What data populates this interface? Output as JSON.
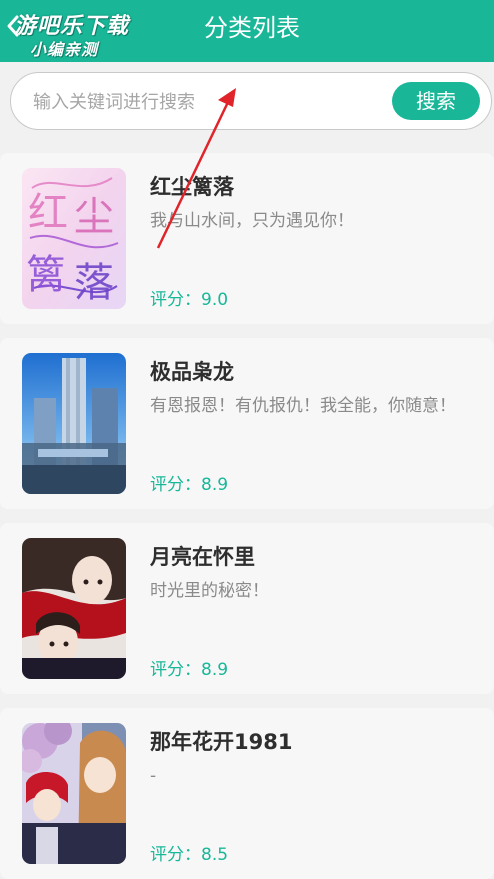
{
  "header": {
    "title": "分类列表",
    "watermark_line1": "游吧乐下载",
    "watermark_line2": "小编亲测"
  },
  "search": {
    "placeholder": "输入关键词进行搜索",
    "value": "",
    "button_label": "搜索"
  },
  "books": [
    {
      "title": "红尘篱落",
      "description": "我与山水间，只为遇见你！",
      "score": "评分：9.0",
      "cover_text": "红尘篱落"
    },
    {
      "title": "极品枭龙",
      "description": "有恩报恩！有仇报仇！我全能，你随意！",
      "score": "评分：8.9"
    },
    {
      "title": "月亮在怀里",
      "description": "时光里的秘密！",
      "score": "评分：8.9"
    },
    {
      "title": "那年花开1981",
      "description": "-",
      "score": "评分：8.5"
    }
  ],
  "colors": {
    "accent": "#19b798",
    "annotation_arrow": "#e0242a"
  }
}
